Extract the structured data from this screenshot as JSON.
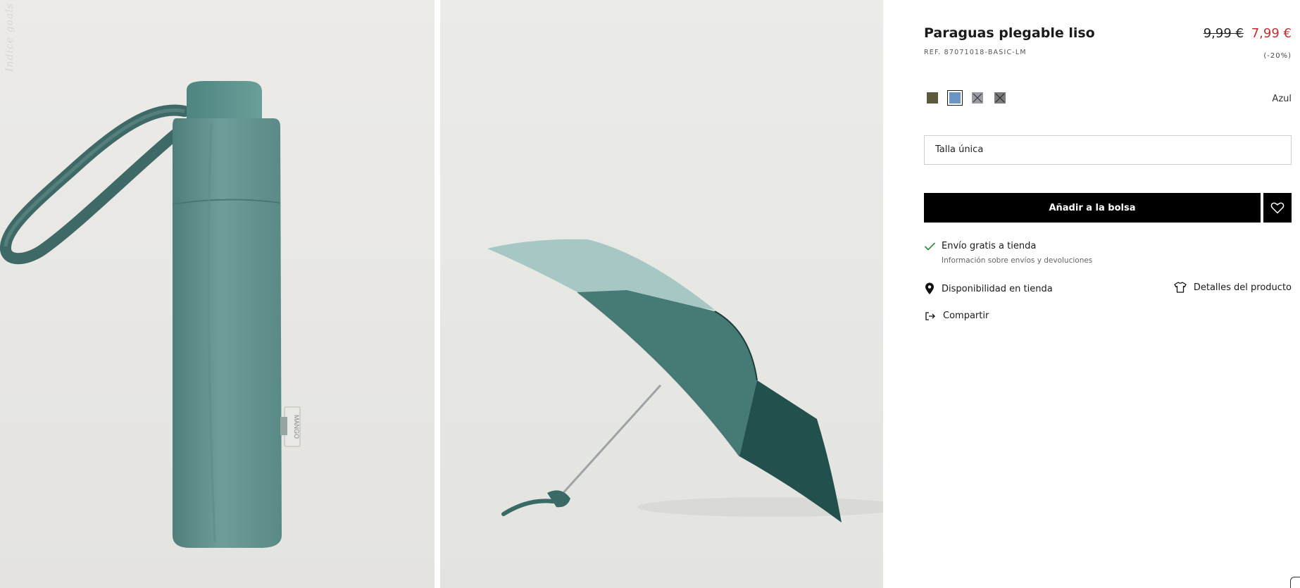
{
  "gallery": {
    "watermark": "Indice goals",
    "tag_text": "MANGO"
  },
  "product": {
    "title": "Paraguas plegable liso",
    "ref": "REF. 87071018-BASIC-LM",
    "old_price": "9,99 €",
    "new_price": "7,99 €",
    "discount": "(-20%)",
    "price_color": "#c62e2e"
  },
  "colors": {
    "selected_name": "Azul",
    "swatches": [
      {
        "color": "#5b5a3c",
        "available": true,
        "selected": false
      },
      {
        "color": "#6b95c5",
        "available": true,
        "selected": true
      },
      {
        "color": "#9a9ca3",
        "available": false,
        "selected": false
      },
      {
        "color": "#7b7b7b",
        "available": false,
        "selected": false
      }
    ]
  },
  "size": {
    "value": "Talla única"
  },
  "actions": {
    "add_to_bag": "Añadir a la bolsa",
    "wishlist_icon": "heart-icon"
  },
  "shipping": {
    "title": "Envío gratis a tienda",
    "info_link": "Información sobre envíos y devoluciones"
  },
  "links": {
    "availability": "Disponibilidad en tienda",
    "details": "Detalles del producto",
    "share": "Compartir"
  }
}
